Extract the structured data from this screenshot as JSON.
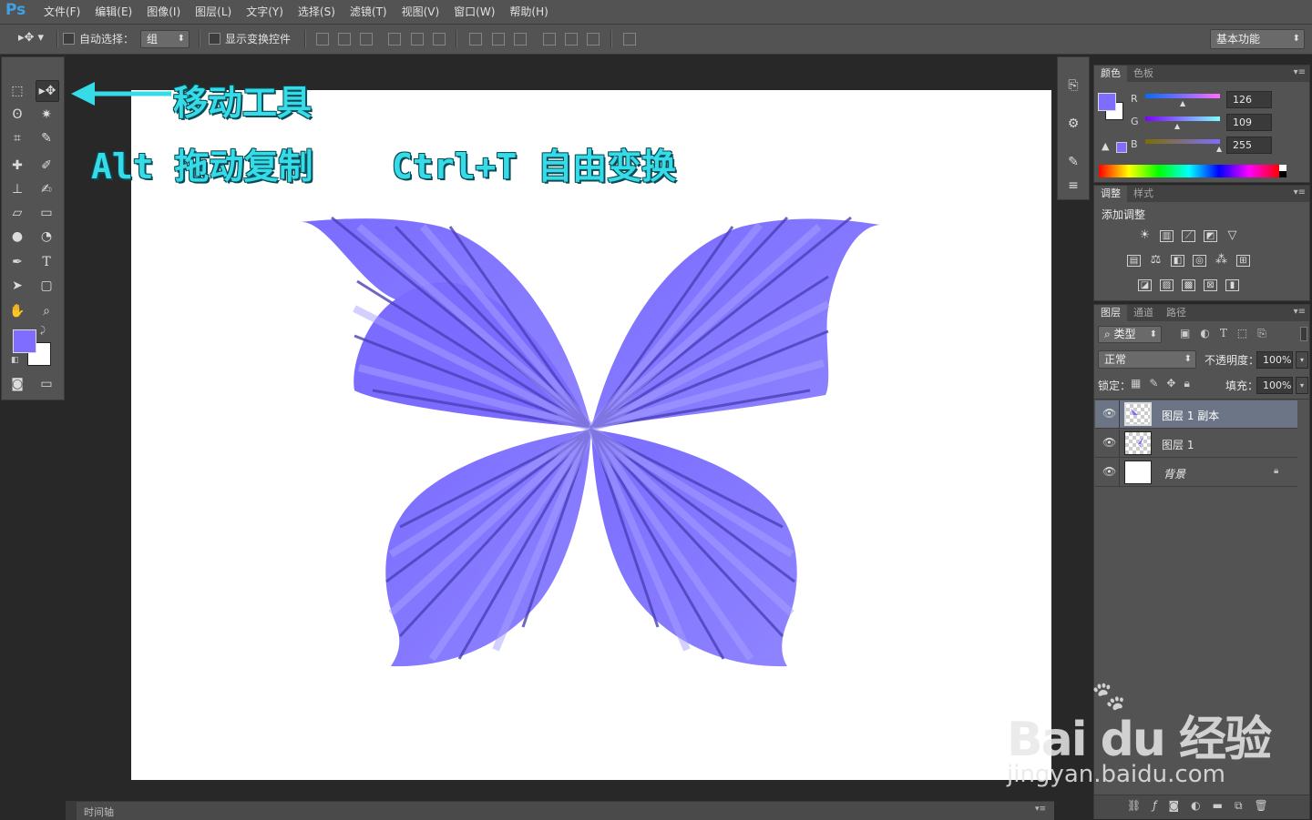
{
  "app": {
    "logo": "Ps"
  },
  "menu": [
    "文件(F)",
    "编辑(E)",
    "图像(I)",
    "图层(L)",
    "文字(Y)",
    "选择(S)",
    "滤镜(T)",
    "视图(V)",
    "窗口(W)",
    "帮助(H)"
  ],
  "options": {
    "auto_select_label": "自动选择：",
    "auto_select_value": "组",
    "show_transform_label": "显示变换控件",
    "workspace": "基本功能"
  },
  "annotations": {
    "move_tool": "移动工具",
    "alt_drag": "Alt 拖动复制",
    "ctrl_t": "Ctrl+T 自由变换"
  },
  "color_panel": {
    "tabs": [
      "颜色",
      "色板"
    ],
    "r_label": "R",
    "g_label": "G",
    "b_label": "B",
    "r": "126",
    "g": "109",
    "b": "255",
    "fg_color": "#7e6dff"
  },
  "adjust_panel": {
    "tabs": [
      "调整",
      "样式"
    ],
    "heading": "添加调整"
  },
  "layers_panel": {
    "tabs": [
      "图层",
      "通道",
      "路径"
    ],
    "filter_kind": "类型",
    "blend_mode": "正常",
    "opacity_label": "不透明度：",
    "opacity": "100%",
    "lock_label": "锁定：",
    "fill_label": "填充：",
    "fill": "100%",
    "layers": [
      {
        "name": "图层 1 副本"
      },
      {
        "name": "图层 1"
      },
      {
        "name": "背景"
      }
    ]
  },
  "status": {
    "timeline": "时间轴"
  },
  "watermark": {
    "brand": "Bai du 经验",
    "url": "jingyan.baidu.com"
  }
}
